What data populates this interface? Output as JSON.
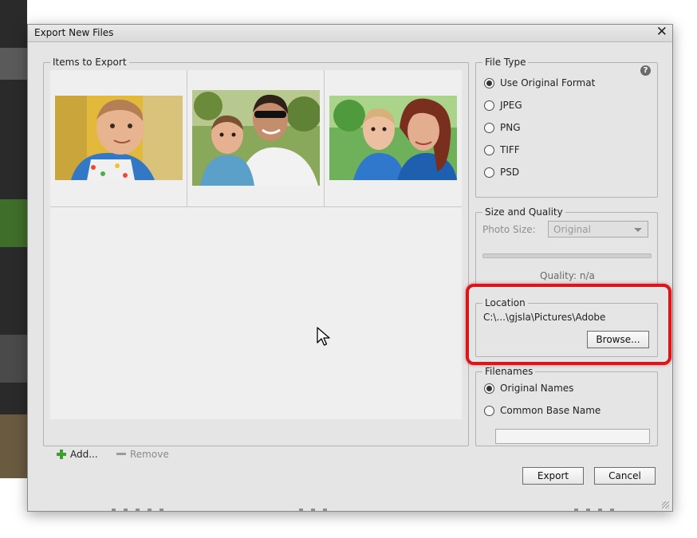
{
  "dialog": {
    "title": "Export New Files"
  },
  "items_panel": {
    "legend": "Items to Export",
    "thumbnails": [
      {
        "subject": "baby in high chair",
        "colors": {
          "bg": "#e6c23a",
          "accent": "#2f7fc9",
          "face": "#e7b08f"
        }
      },
      {
        "subject": "father holding baby",
        "colors": {
          "bg": "#6d8f3a",
          "accent": "#3b8fc6",
          "face": "#c99370"
        }
      },
      {
        "subject": "mother with baby",
        "colors": {
          "bg": "#5ea44a",
          "accent": "#2c73c7",
          "face": "#e2ae90"
        }
      }
    ],
    "add_label": "Add...",
    "remove_label": "Remove"
  },
  "file_type": {
    "legend": "File Type",
    "options": [
      {
        "label": "Use Original Format",
        "selected": true
      },
      {
        "label": "JPEG",
        "selected": false
      },
      {
        "label": "PNG",
        "selected": false
      },
      {
        "label": "TIFF",
        "selected": false
      },
      {
        "label": "PSD",
        "selected": false
      }
    ],
    "help_symbol": "?"
  },
  "size_quality": {
    "legend": "Size and Quality",
    "photo_size_label": "Photo Size:",
    "photo_size_value": "Original",
    "quality_label": "Quality: n/a"
  },
  "location": {
    "legend": "Location",
    "path": "C:\\...\\gjsla\\Pictures\\Adobe",
    "browse_label": "Browse..."
  },
  "filenames": {
    "legend": "Filenames",
    "options": [
      {
        "label": "Original Names",
        "selected": true
      },
      {
        "label": "Common Base Name",
        "selected": false
      }
    ],
    "base_name_value": ""
  },
  "footer": {
    "export_label": "Export",
    "cancel_label": "Cancel"
  },
  "colors": {
    "highlight": "#d9161c",
    "dialog_bg": "#e5e5e5"
  }
}
